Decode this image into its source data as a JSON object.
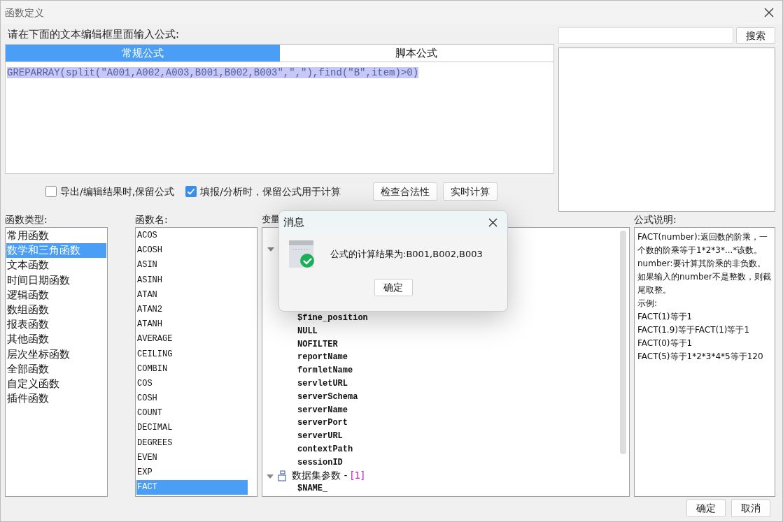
{
  "window": {
    "title": "函数定义"
  },
  "prompt": "请在下面的文本编辑框里面输入公式:",
  "search": {
    "button": "搜索"
  },
  "tabs": [
    {
      "label": "常规公式",
      "selected": true
    },
    {
      "label": "脚本公式",
      "selected": false
    }
  ],
  "editor": {
    "formula": "GREPARRAY(split(\"A001,A002,A003,B001,B002,B003\",\",\"),find(\"B\",item)>0)",
    "selected": true
  },
  "options": [
    {
      "label": "导出/编辑结果时,保留公式",
      "checked": false
    },
    {
      "label": "填报/分析时，保留公式用于计算",
      "checked": true
    }
  ],
  "actions": [
    "检查合法性",
    "实时计算"
  ],
  "function_types": {
    "label": "函数类型:",
    "items": [
      {
        "label": "常用函数",
        "selected": false
      },
      {
        "label": "数学和三角函数",
        "selected": true
      },
      {
        "label": "文本函数",
        "selected": false
      },
      {
        "label": "时间日期函数",
        "selected": false
      },
      {
        "label": "逻辑函数",
        "selected": false
      },
      {
        "label": "数组函数",
        "selected": false
      },
      {
        "label": "报表函数",
        "selected": false
      },
      {
        "label": "其他函数",
        "selected": false
      },
      {
        "label": "层次坐标函数",
        "selected": false
      },
      {
        "label": "全部函数",
        "selected": false
      },
      {
        "label": "自定义函数",
        "selected": false
      },
      {
        "label": "插件函数",
        "selected": false
      }
    ]
  },
  "function_names": {
    "label": "函数名:",
    "items": [
      {
        "label": "ACOS",
        "selected": false
      },
      {
        "label": "ACOSH",
        "selected": false
      },
      {
        "label": "ASIN",
        "selected": false
      },
      {
        "label": "ASINH",
        "selected": false
      },
      {
        "label": "ATAN",
        "selected": false
      },
      {
        "label": "ATAN2",
        "selected": false
      },
      {
        "label": "ATANH",
        "selected": false
      },
      {
        "label": "AVERAGE",
        "selected": false
      },
      {
        "label": "CEILING",
        "selected": false
      },
      {
        "label": "COMBIN",
        "selected": false
      },
      {
        "label": "COS",
        "selected": false
      },
      {
        "label": "COSH",
        "selected": false
      },
      {
        "label": "COUNT",
        "selected": false
      },
      {
        "label": "DECIMAL",
        "selected": false
      },
      {
        "label": "DEGREES",
        "selected": false
      },
      {
        "label": "EVEN",
        "selected": false
      },
      {
        "label": "EXP",
        "selected": false
      },
      {
        "label": "FACT",
        "selected": true
      }
    ]
  },
  "variables": {
    "label": "变量",
    "items": [
      "$fine_position",
      "NULL",
      "NOFILTER",
      "reportName",
      "formletName",
      "servletURL",
      "serverSchema",
      "serverName",
      "serverPort",
      "serverURL",
      "contextPath",
      "sessionID"
    ],
    "groups": [
      {
        "label": "数据集参数 - ",
        "count": "[1]",
        "expanded": true,
        "children": [
          "$NAME_"
        ]
      }
    ]
  },
  "description": {
    "label": "公式说明:",
    "paragraphs": [
      "FACT(number):返回数的阶乘，一个数的阶乘等于1*2*3*...*该数。",
      "number:要计算其阶乘的非负数。如果输入的number不是整数，则截尾取整。",
      "示例:",
      "FACT(1)等于1",
      "FACT(1.9)等于FACT(1)等于1",
      "FACT(0)等于1",
      "FACT(5)等于1*2*3*4*5等于120"
    ]
  },
  "footer": [
    "确定",
    "取消"
  ],
  "dialog": {
    "title": "消息",
    "message": "公式的计算结果为:B001,B002,B003",
    "button": "确定"
  }
}
